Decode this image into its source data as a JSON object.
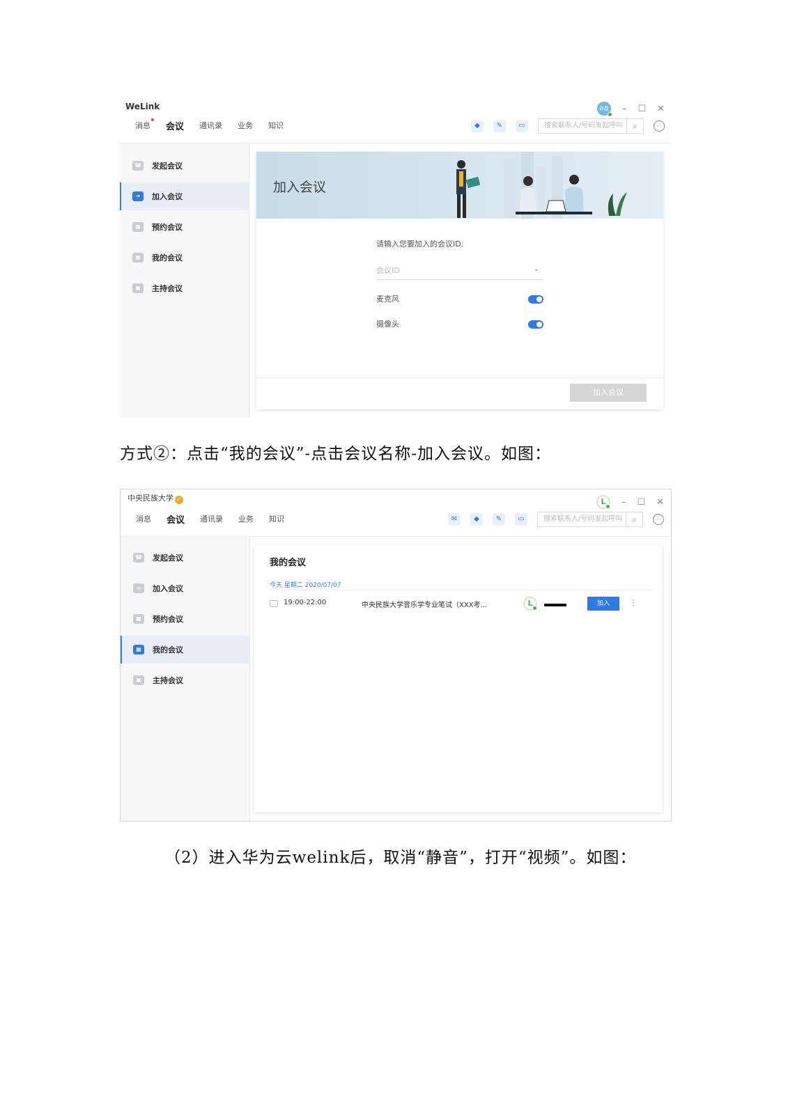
{
  "screenshot1": {
    "app_name": "WeLink",
    "nav": [
      "消息",
      "会议",
      "通讯录",
      "业务",
      "知识"
    ],
    "nav_active_index": 1,
    "avatar_text": "卯昌",
    "search_placeholder": "搜索联系人/号码发起呼叫",
    "sidebar": [
      "发起会议",
      "加入会议",
      "预约会议",
      "我的会议",
      "主持会议"
    ],
    "sidebar_active_index": 1,
    "banner_title": "加入会议",
    "form": {
      "prompt": "请输入您要加入的会议ID:",
      "meeting_id_placeholder": "会议ID",
      "mic_label": "麦克风",
      "camera_label": "摄像头"
    },
    "join_button": "加入会议"
  },
  "caption1": "方式②：点击“我的会议”-点击会议名称-加入会议。如图：",
  "screenshot2": {
    "org_name": "中央民族大学",
    "nav": [
      "消息",
      "会议",
      "通讯录",
      "业务",
      "知识"
    ],
    "nav_active_index": 1,
    "search_placeholder": "搜索联系人/号码发起呼叫",
    "sidebar": [
      "发起会议",
      "加入会议",
      "预约会议",
      "我的会议",
      "主持会议"
    ],
    "sidebar_active_index": 3,
    "panel_title": "我的会议",
    "date_line": "今天 星期二 2020/07/07",
    "meeting": {
      "time": "19:00-22:00",
      "name": "中央民族大学音乐学专业笔试（XXX考...",
      "join_label": "加入"
    }
  },
  "caption2": "（2）进入华为云welink后，取消“静音”，打开“视频”。如图："
}
